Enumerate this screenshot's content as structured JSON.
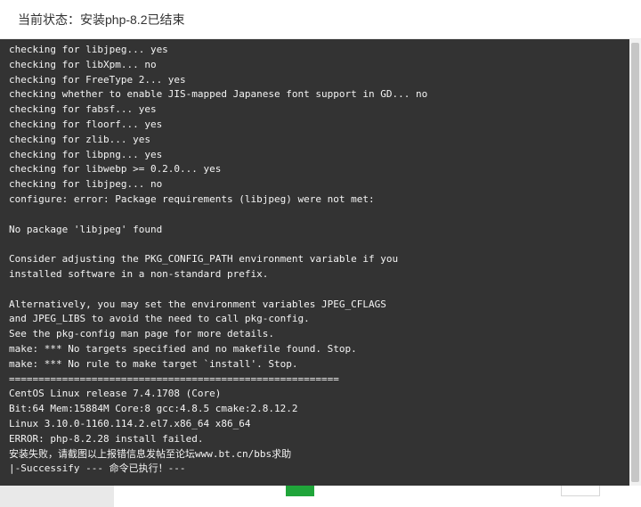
{
  "dialog": {
    "title": "当前状态：安装php-8.2已结束"
  },
  "terminal": {
    "lines": [
      "checking for libjpeg... yes",
      "checking for libXpm... no",
      "checking for FreeType 2... yes",
      "checking whether to enable JIS-mapped Japanese font support in GD... no",
      "checking for fabsf... yes",
      "checking for floorf... yes",
      "checking for zlib... yes",
      "checking for libpng... yes",
      "checking for libwebp >= 0.2.0... yes",
      "checking for libjpeg... no",
      "configure: error: Package requirements (libjpeg) were not met:",
      "",
      "No package 'libjpeg' found",
      "",
      "Consider adjusting the PKG_CONFIG_PATH environment variable if you",
      "installed software in a non-standard prefix.",
      "",
      "Alternatively, you may set the environment variables JPEG_CFLAGS",
      "and JPEG_LIBS to avoid the need to call pkg-config.",
      "See the pkg-config man page for more details.",
      "make: *** No targets specified and no makefile found. Stop.",
      "make: *** No rule to make target `install'. Stop.",
      "========================================================",
      "CentOS Linux release 7.4.1708 (Core)",
      "Bit:64 Mem:15884M Core:8 gcc:4.8.5 cmake:2.8.12.2",
      "Linux 3.10.0-1160.114.2.el7.x86_64 x86_64",
      "ERROR: php-8.2.28 install failed.",
      "安装失败，请截图以上报错信息发帖至论坛www.bt.cn/bbs求助",
      "|-Successify --- 命令已执行！---"
    ]
  },
  "colors": {
    "terminal_bg": "#333333",
    "terminal_text": "#f4f4f4",
    "accent": "#20a53a"
  }
}
